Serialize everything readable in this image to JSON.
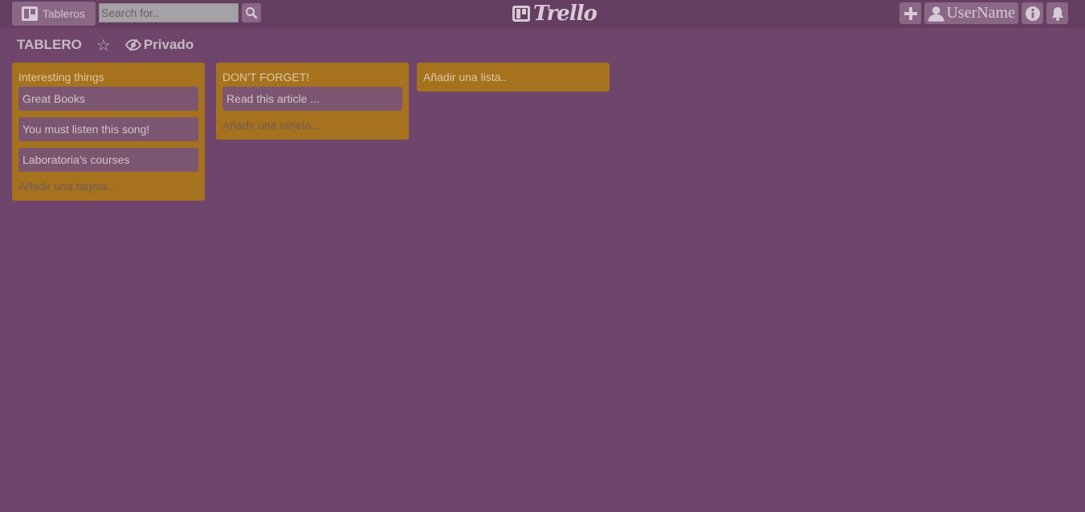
{
  "topbar": {
    "boards_label": "Tableros",
    "search_placeholder": "Search for..",
    "logo_text": "Trello",
    "username": "UserName"
  },
  "board": {
    "title": "TABLERO",
    "privacy_label": "Privado"
  },
  "lists": [
    {
      "title": "Interesting things",
      "cards": [
        "Great Books",
        "You must listen this song!",
        "Laboratoria's courses"
      ],
      "add_card_label": "Añadir una tarjeta..."
    },
    {
      "title": "DON'T FORGET!",
      "cards": [
        "Read this article ..."
      ],
      "add_card_label": "Añadir una tarjeta..."
    }
  ],
  "add_list_label": "Añadir una lista..",
  "colors": {
    "background": "#6f456b",
    "list": "#a7721e",
    "card": "#7c5670"
  }
}
